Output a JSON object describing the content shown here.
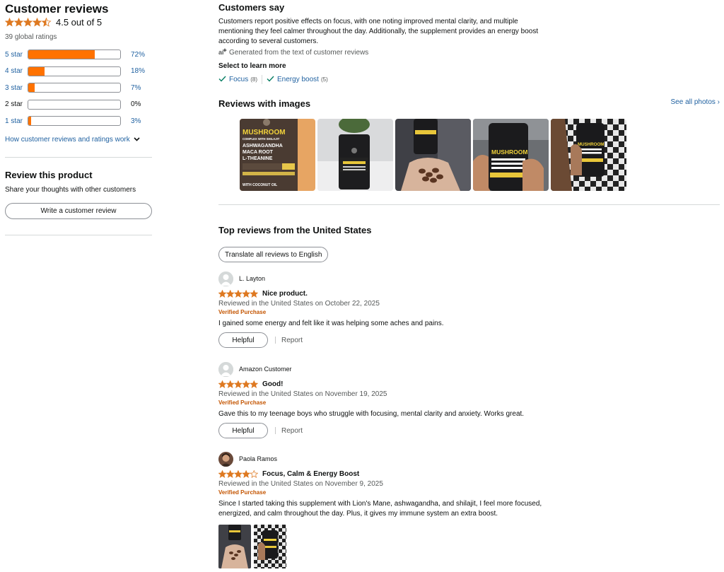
{
  "ratings": {
    "heading": "Customer reviews",
    "average_text": "4.5 out of 5",
    "average_value": 4.5,
    "global_ratings": "39 global ratings",
    "histogram": [
      {
        "label": "5 star",
        "percent_text": "72%",
        "percent": 72,
        "link": true
      },
      {
        "label": "4 star",
        "percent_text": "18%",
        "percent": 18,
        "link": true
      },
      {
        "label": "3 star",
        "percent_text": "7%",
        "percent": 7,
        "link": true
      },
      {
        "label": "2 star",
        "percent_text": "0%",
        "percent": 0,
        "link": false
      },
      {
        "label": "1 star",
        "percent_text": "3%",
        "percent": 3,
        "link": true
      }
    ],
    "how_link": "How customer reviews and ratings work"
  },
  "review_product": {
    "heading": "Review this product",
    "subtext": "Share your thoughts with other customers",
    "button_label": "Write a customer review"
  },
  "customers_say": {
    "heading": "Customers say",
    "summary": "Customers report positive effects on focus, with one noting improved mental clarity, and multiple mentioning they feel calmer throughout the day. Additionally, the supplement provides an energy boost according to several customers.",
    "ai_note": "Generated from the text of customer reviews",
    "select_label": "Select to learn more",
    "chips": [
      {
        "label": "Focus",
        "count": "(8)"
      },
      {
        "label": "Energy boost",
        "count": "(5)"
      }
    ]
  },
  "reviews_with_images": {
    "heading": "Reviews with images",
    "see_all": "See all photos",
    "product_label": {
      "line1": "MUSHROOM",
      "line2": "COMPLEX WITH SHILAJIT",
      "line3": "ASHWAGANDHA",
      "line4": "MACA ROOT",
      "line5": "L-THEANINE",
      "line6": "WITH COCONUT OIL"
    }
  },
  "top_reviews": {
    "heading": "Top reviews from the United States",
    "translate_button": "Translate all reviews to English",
    "helpful_label": "Helpful",
    "report_label": "Report",
    "items": [
      {
        "author": "L. Layton",
        "rating": 5,
        "title": "Nice product.",
        "date": "Reviewed in the United States on October 22, 2025",
        "verified": "Verified Purchase",
        "body": "I gained some energy and felt like it was helping some aches and pains."
      },
      {
        "author": "Amazon Customer",
        "rating": 5,
        "title": "Good!",
        "date": "Reviewed in the United States on November 19, 2025",
        "verified": "Verified Purchase",
        "body": "Gave this to my teenage boys who struggle with focusing, mental clarity and anxiety. Works great."
      },
      {
        "author": "Paola Ramos",
        "rating": 4,
        "title": "Focus, Calm & Energy Boost",
        "date": "Reviewed in the United States on November 9, 2025",
        "verified": "Verified Purchase",
        "body": "Since I started taking this supplement with Lion's Mane, ashwagandha, and shilajit, I feel more focused, energized, and calm throughout the day. Plus, it gives my immune system an extra boost."
      }
    ]
  },
  "colors": {
    "star": "#de7921",
    "bar_fill": "#ff7200",
    "link": "#2162a1",
    "verified": "#c45500"
  }
}
